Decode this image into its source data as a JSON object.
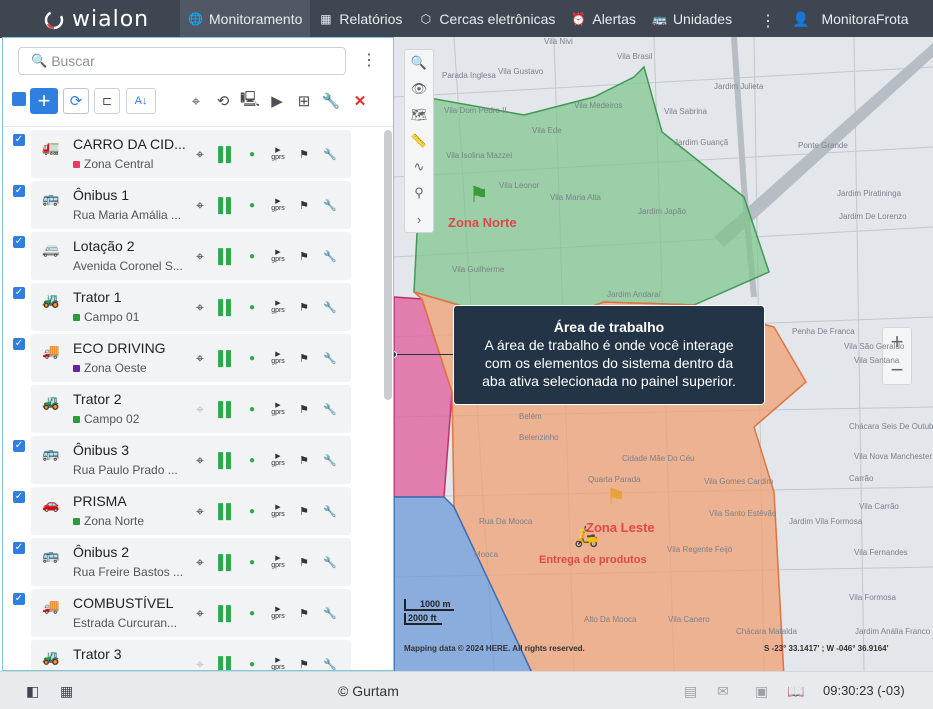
{
  "app": {
    "logo_text": "wialon"
  },
  "nav": {
    "items": [
      {
        "label": "Monitoramento",
        "icon": "globe-icon"
      },
      {
        "label": "Relatórios",
        "icon": "report-icon"
      },
      {
        "label": "Cercas eletrônicas",
        "icon": "geofence-icon"
      },
      {
        "label": "Alertas",
        "icon": "alarm-icon"
      },
      {
        "label": "Unidades",
        "icon": "bus-icon"
      }
    ],
    "more": "⋮",
    "user": "MonitoraFrota"
  },
  "panel": {
    "search_placeholder": "Buscar",
    "menu": "⋮",
    "units": [
      {
        "name": "CARRO DA CID...",
        "sub": "Zona Central",
        "dot": "#e83a6a",
        "icon": "🚛",
        "checked": true,
        "locate_active": true
      },
      {
        "name": "Ônibus 1",
        "sub": "Rua Maria Amália ...",
        "dot": "",
        "icon": "🚌",
        "checked": true,
        "locate_active": true
      },
      {
        "name": "Lotação 2",
        "sub": "Avenida Coronel S...",
        "dot": "",
        "icon": "🚐",
        "checked": true,
        "locate_active": true
      },
      {
        "name": "Trator 1",
        "sub": "Campo 01",
        "dot": "#2a9a3f",
        "icon": "🚜",
        "checked": true,
        "locate_active": true
      },
      {
        "name": "ECO DRIVING",
        "sub": "Zona Oeste",
        "dot": "#6a1fa0",
        "icon": "🚚",
        "checked": true,
        "locate_active": true
      },
      {
        "name": "Trator 2",
        "sub": "Campo 02",
        "dot": "#2a9a3f",
        "icon": "🚜",
        "checked": false,
        "locate_active": false
      },
      {
        "name": "Ônibus 3",
        "sub": "Rua Paulo Prado ...",
        "dot": "",
        "icon": "🚌",
        "checked": true,
        "locate_active": true
      },
      {
        "name": "PRISMA",
        "sub": "Zona Norte",
        "dot": "#2a9a3f",
        "icon": "🚗",
        "checked": true,
        "locate_active": true
      },
      {
        "name": "Ônibus 2",
        "sub": "Rua Freire Bastos ...",
        "dot": "",
        "icon": "🚌",
        "checked": true,
        "locate_active": true
      },
      {
        "name": "COMBUSTÍVEL",
        "sub": "Estrada Curcuran...",
        "dot": "",
        "icon": "🚚",
        "checked": true,
        "locate_active": true
      },
      {
        "name": "Trator 3",
        "sub": "",
        "dot": "",
        "icon": "🚜",
        "checked": false,
        "locate_active": false
      }
    ],
    "gprs": "gprs"
  },
  "map": {
    "tooltip_title": "Área de trabalho",
    "tooltip_lines": [
      "A área de trabalho é onde você interage",
      "com os elementos do sistema dentro da",
      "aba ativa selecionada no painel superior."
    ],
    "zona_norte": "Zona Norte",
    "zona_leste": "Zona Leste",
    "entrega": "Entrega de produtos",
    "streets": [
      "Vila Nivi",
      "Vila Brasil",
      "Vila Gustavo",
      "Parada Inglesa",
      "Jardim Julieta",
      "Vila Medeiros",
      "Vila Dom Pedro II",
      "Vila Sabrina",
      "Vila Ede",
      "Jardim Guançã",
      "Ponte Grande",
      "Vila Isolina Mazzei",
      "Vila Leonor",
      "Vila Maria Alta",
      "Jardim Japão",
      "Jardim Piratininga",
      "Jardim De Lorenzo",
      "Vila Guilherme",
      "Jardim Andaraí",
      "Penha De Franca",
      "Vila Santana",
      "Vila São Geraldo",
      "Belém",
      "Belenzinho",
      "Cidade Mãe Do Céu",
      "Quarta Parada",
      "Vila Gomes Cardim",
      "Vila Santo Estêvão",
      "Jardim Vila Formosa",
      "Vila Fernandes",
      "Vila Regente Feijó",
      "Mooca",
      "Alto Da Mooca",
      "Vila Canero",
      "Chácara Mafalda",
      "Jardim Anália Franco",
      "Vila Formosa",
      "Carrão",
      "Vila Carrão",
      "Chácara Seis De Outubro",
      "Vila Nova Manchester",
      "Rua Da Mooca"
    ],
    "scale_1": "1000 m",
    "scale_2": "2000 ft",
    "copyright": "Mapping data © 2024 HERE. All rights reserved.",
    "coords": "S -23° 33.1417' ; W -046° 36.9164'",
    "colors": {
      "green": "#7cc48a",
      "pink": "#e0649e",
      "orange": "#f0a074",
      "blue": "#6c9ad8"
    }
  },
  "footer": {
    "copyright": "© Gurtam",
    "time": "09:30:23 (-03)"
  }
}
